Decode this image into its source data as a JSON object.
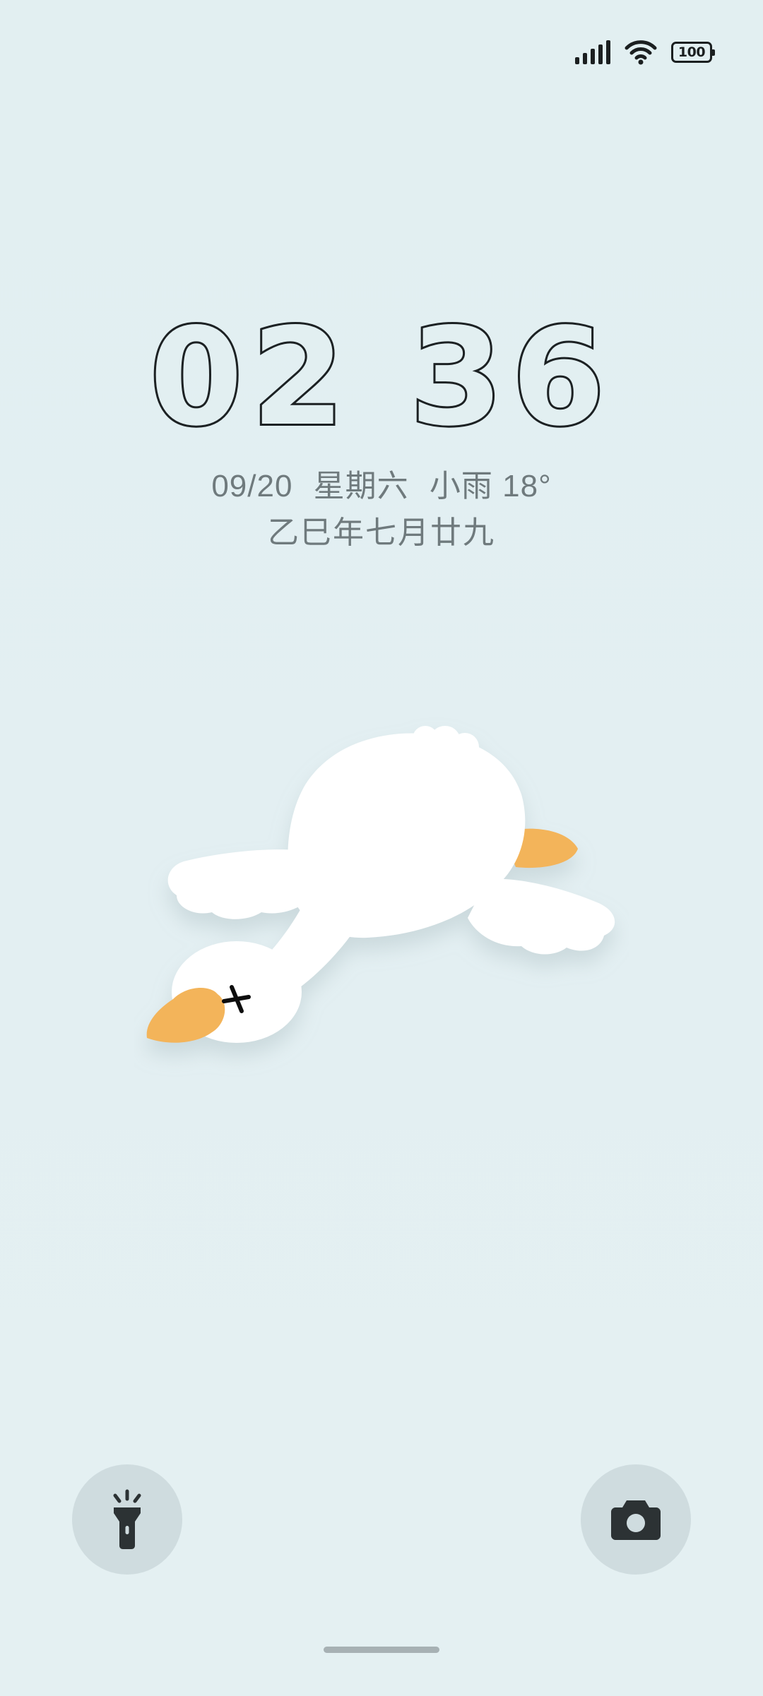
{
  "status_bar": {
    "signal_icon": "cellular-signal-icon",
    "wifi_icon": "wifi-icon",
    "battery_level": "100"
  },
  "clock": {
    "hours": "02",
    "minutes": "36"
  },
  "date": {
    "date": "09/20",
    "weekday": "星期六",
    "weather": "小雨 18°"
  },
  "lunar_date": "乙巳年七月廿九",
  "wallpaper": {
    "subject": "goose-illustration"
  },
  "quick_actions": {
    "flashlight_icon": "flashlight-icon",
    "camera_icon": "camera-icon"
  },
  "colors": {
    "background": "#e3eff1",
    "clock_stroke": "#1c2123",
    "secondary_text": "#6f7a7d",
    "beak_orange": "#f3b45a",
    "button_bg": "#cfdcdf"
  }
}
